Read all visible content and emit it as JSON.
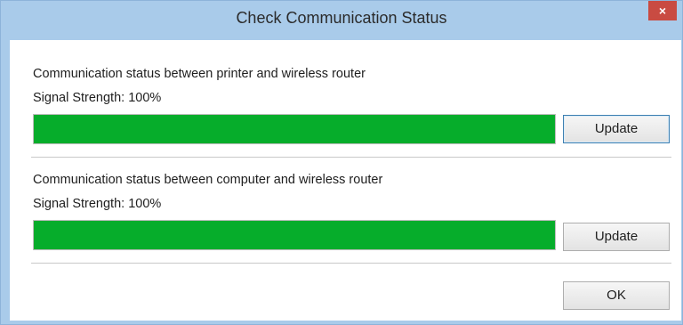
{
  "window": {
    "title": "Check Communication Status",
    "close_label": "×"
  },
  "sections": [
    {
      "title": "Communication status between printer and wireless router",
      "signal_text": "Signal Strength: 100%",
      "signal_percent": 100,
      "button_label": "Update"
    },
    {
      "title": "Communication status between computer and wireless router",
      "signal_text": "Signal Strength: 100%",
      "signal_percent": 100,
      "button_label": "Update"
    }
  ],
  "footer": {
    "ok_label": "OK"
  },
  "colors": {
    "titlebar": "#a9cbea",
    "close_button": "#c94b42",
    "signal_bar": "#06ad2b"
  }
}
